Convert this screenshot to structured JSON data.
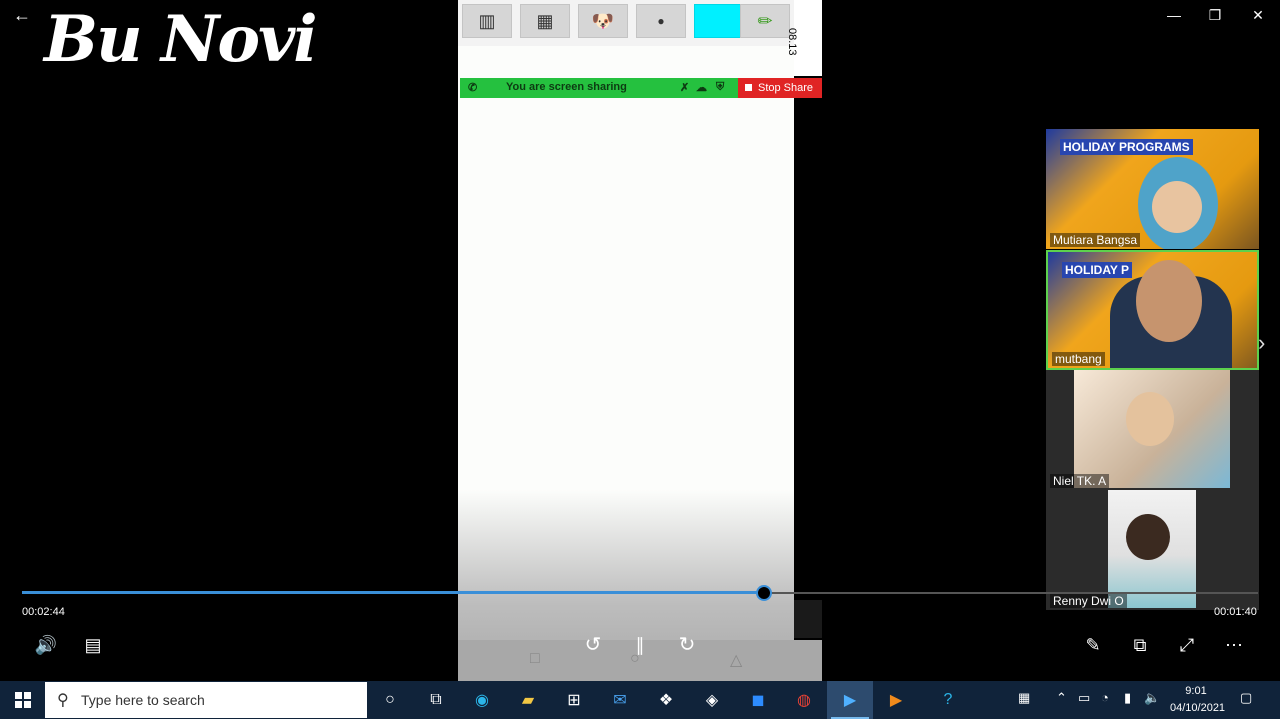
{
  "window": {
    "logo_text": "Bu Novi",
    "back_icon": "back-arrow-icon",
    "minimize_glyph": "—",
    "restore_glyph": "❐",
    "close_glyph": "✕"
  },
  "phone": {
    "status_time": "08.13",
    "share_bar": {
      "text": "You are screen sharing",
      "stop_label": "Stop Share"
    },
    "tools": [
      {
        "icon": "brush-set-icon",
        "glyph": "▥"
      },
      {
        "icon": "film-strip-icon",
        "glyph": "▦"
      },
      {
        "icon": "sticker-icon",
        "glyph": "🐶"
      },
      {
        "icon": "brush-size-icon",
        "glyph": "●"
      },
      {
        "icon": "color-swatch-icon",
        "glyph": ""
      },
      {
        "icon": "pencil-tool-icon",
        "glyph": "✏"
      }
    ],
    "accent_color": "#00f0ff",
    "share_color": "#25c13f",
    "stop_color": "#e02424"
  },
  "participants": [
    {
      "name": "Mutiara Bangsa",
      "banner": "HOLIDAY PROGRAMS"
    },
    {
      "name": "mutbang",
      "banner": "HOLIDAY P"
    },
    {
      "name": "Niel TK. A"
    },
    {
      "name": "Renny Dwi O"
    }
  ],
  "player": {
    "elapsed": "00:02:44",
    "remaining": "00:01:40",
    "progress": 0.6
  },
  "taskbar": {
    "search_placeholder": "Type here to search",
    "time": "9:01",
    "date": "04/10/2021"
  }
}
